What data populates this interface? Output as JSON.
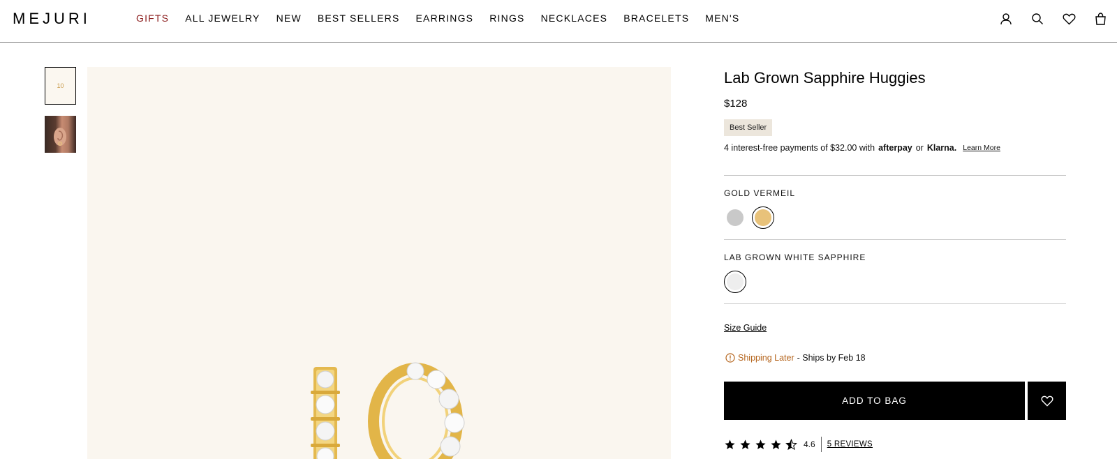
{
  "header": {
    "logo": "MEJURI",
    "nav": [
      {
        "label": "GIFTS",
        "active": true
      },
      {
        "label": "ALL JEWELRY"
      },
      {
        "label": "NEW"
      },
      {
        "label": "BEST SELLERS"
      },
      {
        "label": "EARRINGS"
      },
      {
        "label": "RINGS"
      },
      {
        "label": "NECKLACES"
      },
      {
        "label": "BRACELETS"
      },
      {
        "label": "MEN'S"
      }
    ],
    "icons": [
      "account-icon",
      "search-icon",
      "heart-icon",
      "bag-icon"
    ]
  },
  "gallery": {
    "thumb1_label": "10"
  },
  "product": {
    "title": "Lab Grown Sapphire Huggies",
    "price": "$128",
    "badge": "Best Seller",
    "installments": {
      "text": "4 interest-free payments of $32.00 with",
      "afterpay": "afterpay",
      "or": "or",
      "klarna": "Klarna.",
      "learn_more": "Learn More"
    },
    "metal": {
      "label": "GOLD VERMEIL",
      "options": [
        {
          "name": "silver",
          "color": "#c9c9c9",
          "selected": false
        },
        {
          "name": "gold",
          "color": "#e8c27a",
          "selected": true
        }
      ]
    },
    "stone": {
      "label": "LAB GROWN WHITE SAPPHIRE",
      "options": [
        {
          "name": "white-sapphire",
          "color": "#eeeeee",
          "selected": true
        }
      ]
    },
    "size_guide": "Size Guide",
    "shipping": {
      "status": "Shipping Later",
      "detail": "- Ships by Feb 18",
      "color": "#b5651d"
    },
    "add_to_bag": "ADD TO BAG",
    "rating": {
      "value": "4.6",
      "stars": 4.5,
      "reviews": "5 REVIEWS"
    }
  },
  "colors": {
    "accent_nav": "#8b1c1c",
    "image_bg": "#faf6ef",
    "button": "#000000"
  }
}
